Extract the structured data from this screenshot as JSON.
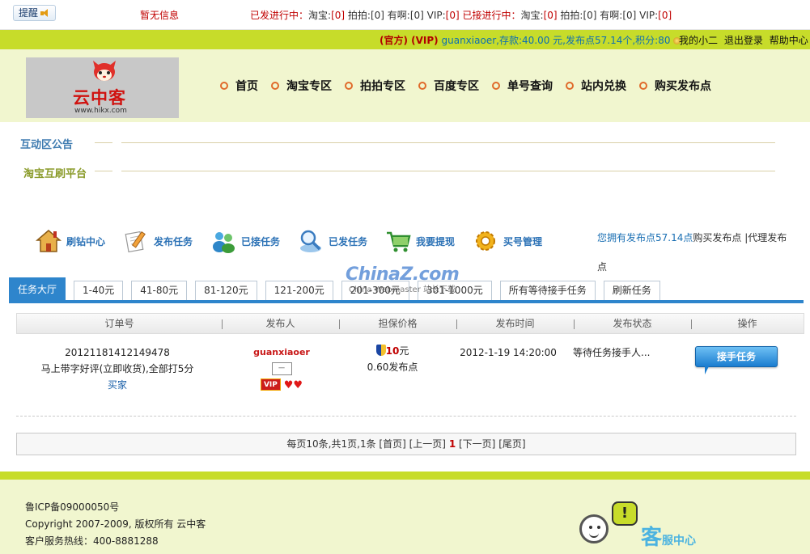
{
  "notice": {
    "remind_label": "提醒",
    "no_message": "暂无信息",
    "published_label": "已发进行中：",
    "taobao_label": "淘宝:",
    "paipai_label": "拍拍:",
    "youa_label": "有啊:",
    "vip_label": "VIP:",
    "accepted_label": "已接进行中：",
    "counts": {
      "pub_taobao": "[0]",
      "pub_paipai": "[0]",
      "pub_youa": "[0]",
      "pub_vip": "[0]",
      "acc_taobao": "[0]",
      "acc_paipai": "[0]",
      "acc_youa": "[0]",
      "acc_vip": "[0]"
    }
  },
  "account": {
    "official": "(官方) (VIP)",
    "username": "guanxiaoer",
    "balance_text": ",存款:40.00 元,发布点57.14个,积分:80",
    "links": [
      "我的小二",
      "退出登录",
      "帮助中心"
    ]
  },
  "logo": {
    "text": "云中客",
    "url": "www.hikx.com"
  },
  "nav": {
    "items": [
      "首页",
      "淘宝专区",
      "拍拍专区",
      "百度专区",
      "单号查询",
      "站内兑换",
      "购买发布点"
    ]
  },
  "announcements": {
    "first": "互动区公告",
    "second": "淘宝互刷平台"
  },
  "quick": {
    "items": [
      "刷钻中心",
      "发布任务",
      "已接任务",
      "已发任务",
      "我要提现",
      "买号管理"
    ]
  },
  "points": {
    "owned": "您拥有发布点57.14点",
    "buy": "购买发布点",
    "agent": "|代理发布点"
  },
  "watermark": {
    "main": "ChinaZ.com",
    "sub": "China Webmaster  站长下载"
  },
  "tabs": [
    "任务大厅",
    "1-40元",
    "41-80元",
    "81-120元",
    "121-200元",
    "201-300元",
    "301-1000元",
    "所有等待接手任务",
    "刷新任务"
  ],
  "table": {
    "headers": [
      "订单号",
      "发布人",
      "担保价格",
      "发布时间",
      "发布状态",
      "操作"
    ],
    "row": {
      "order_no": "20121181412149478",
      "desc": "马上带字好评(立即收货),全部打5分",
      "buyer": "买家",
      "publisher": "guanxiaoer",
      "vip_badge": "VIP",
      "price": "10",
      "price_unit": "元",
      "points": "0.60发布点",
      "time": "2012-1-19 14:20:00",
      "state": "等待任务接手人...",
      "action": "接手任务"
    }
  },
  "pager": {
    "summary": "每页10条,共1页,1条",
    "first": "[首页]",
    "prev": "[上一页]",
    "current": "1",
    "next": "[下一页]",
    "last": "[尾页]"
  },
  "footer": {
    "icp": "鲁ICP备09000050号",
    "copyright": "Copyright 2007-2009, 版权所有 云中客",
    "hotline": "客户服务热线：400-8881288",
    "service_big": "客",
    "service_small": "服中心"
  },
  "colors": {
    "accent_green": "#c7dc2a",
    "light_green": "#f1f6cf",
    "tab_blue": "#2e85cc",
    "alert_red": "#c00000"
  }
}
